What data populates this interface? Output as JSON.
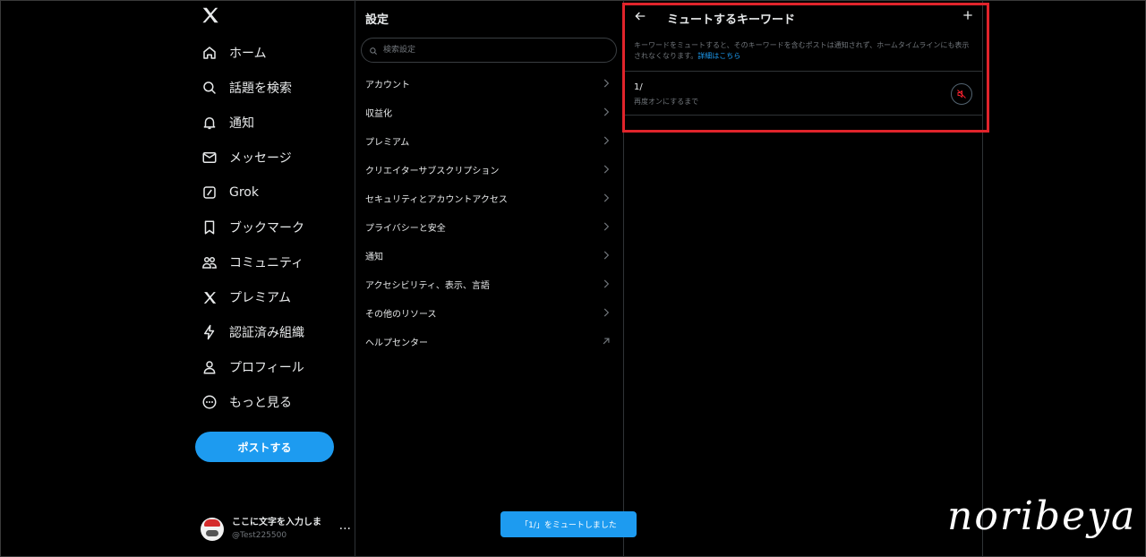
{
  "nav": {
    "items": [
      {
        "label": "ホーム",
        "icon": "home-icon"
      },
      {
        "label": "話題を検索",
        "icon": "search-icon"
      },
      {
        "label": "通知",
        "icon": "bell-icon"
      },
      {
        "label": "メッセージ",
        "icon": "mail-icon"
      },
      {
        "label": "Grok",
        "icon": "grok-icon"
      },
      {
        "label": "ブックマーク",
        "icon": "bookmark-icon"
      },
      {
        "label": "コミュニティ",
        "icon": "community-icon"
      },
      {
        "label": "プレミアム",
        "icon": "x-logo-icon"
      },
      {
        "label": "認証済み組織",
        "icon": "lightning-icon"
      },
      {
        "label": "プロフィール",
        "icon": "person-icon"
      },
      {
        "label": "もっと見る",
        "icon": "more-circle-icon"
      }
    ],
    "post_button": "ポストする",
    "account": {
      "name": "ここに文字を入力しま",
      "handle": "@Test225500",
      "more": "···"
    }
  },
  "settings": {
    "title": "設定",
    "search_placeholder": "検索設定",
    "items": [
      {
        "label": "アカウント",
        "icon": "chevron-right-icon"
      },
      {
        "label": "収益化",
        "icon": "chevron-right-icon"
      },
      {
        "label": "プレミアム",
        "icon": "chevron-right-icon"
      },
      {
        "label": "クリエイターサブスクリプション",
        "icon": "chevron-right-icon"
      },
      {
        "label": "セキュリティとアカウントアクセス",
        "icon": "chevron-right-icon"
      },
      {
        "label": "プライバシーと安全",
        "icon": "chevron-right-icon"
      },
      {
        "label": "通知",
        "icon": "chevron-right-icon"
      },
      {
        "label": "アクセシビリティ、表示、言語",
        "icon": "chevron-right-icon"
      },
      {
        "label": "その他のリソース",
        "icon": "chevron-right-icon"
      },
      {
        "label": "ヘルプセンター",
        "icon": "external-link-icon"
      }
    ]
  },
  "muted": {
    "title": "ミュートするキーワード",
    "description": "キーワードをミュートすると、そのキーワードを含むポストは通知されず、ホームタイムラインにも表示されなくなります。",
    "link": "詳細はこちら",
    "keywords": [
      {
        "word": "1/",
        "subtitle": "再度オンにするまで"
      }
    ]
  },
  "toast": "「1/」をミュートしました",
  "watermark": "noribeya",
  "colors": {
    "accent": "#1d9bf0",
    "highlight": "#e0242b",
    "background": "#000000",
    "muted_icon": "#f4212e"
  }
}
